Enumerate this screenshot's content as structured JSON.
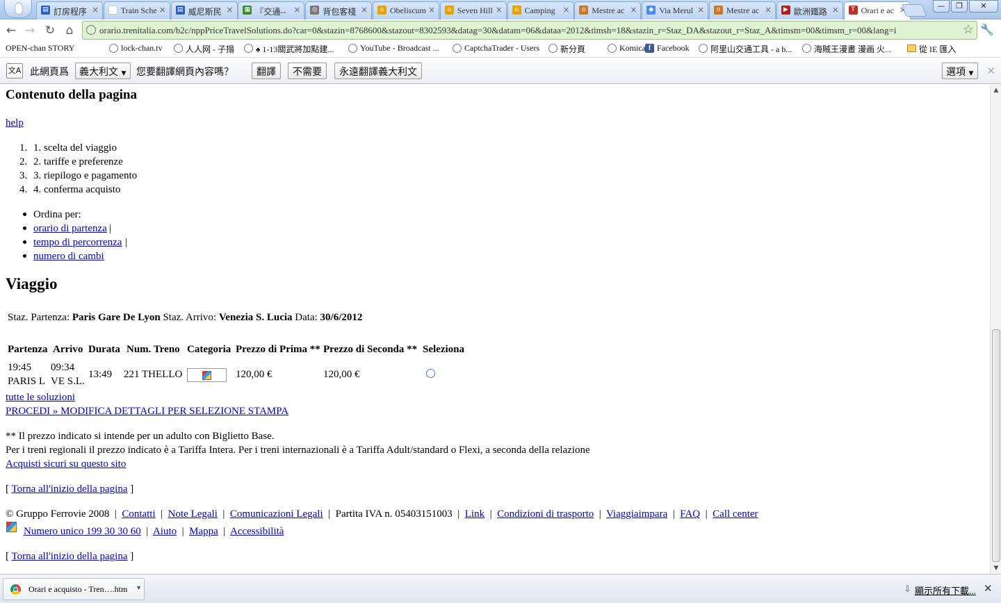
{
  "browser": {
    "tabs": [
      {
        "label": "訂房程序",
        "color": "#2d5fbf",
        "glyph": "▤"
      },
      {
        "label": "Train Sche",
        "color": "#ffffff",
        "glyph": ""
      },
      {
        "label": "威尼斯民",
        "color": "#2d5fbf",
        "glyph": "▤"
      },
      {
        "label": "『交通--",
        "color": "#3a8a3a",
        "glyph": "▦"
      },
      {
        "label": "背包客棧",
        "color": "#777777",
        "glyph": "◎"
      },
      {
        "label": "Obeliscum",
        "color": "#e8a200",
        "glyph": "⌂"
      },
      {
        "label": "Seven Hill",
        "color": "#e8a200",
        "glyph": "⌂"
      },
      {
        "label": "Camping",
        "color": "#e8a200",
        "glyph": "⌂"
      },
      {
        "label": "Mestre ac",
        "color": "#cc7722",
        "glyph": "o"
      },
      {
        "label": "Via Merul",
        "color": "#4a8af4",
        "glyph": "◆"
      },
      {
        "label": "Mestre ac",
        "color": "#cc7722",
        "glyph": "o"
      },
      {
        "label": "歐洲鐵路",
        "color": "#b02020",
        "glyph": "▶"
      },
      {
        "label": "Orari e ac",
        "color": "#c0302a",
        "glyph": "T",
        "active": true
      }
    ],
    "url": "orario.trenitalia.com/b2c/nppPriceTravelSolutions.do?car=0&stazin=8768600&stazout=8302593&datag=30&datam=06&dataa=2012&timsh=18&stazin_r=Staz_DA&stazout_r=Staz_A&timsm=00&timsm_r=00&lang=i",
    "bookmarks": [
      {
        "label": "OPEN-chan STORY",
        "icon": "none"
      },
      {
        "label": "lock-chan.tv",
        "icon": "globe"
      },
      {
        "label": "人人网 - 子搨",
        "icon": "globe"
      },
      {
        "label": "♠ 1-13關武將加點建...",
        "icon": "globe"
      },
      {
        "label": "YouTube - Broadcast ...",
        "icon": "globe"
      },
      {
        "label": "CaptchaTrader - Users",
        "icon": "globe"
      },
      {
        "label": "新分頁",
        "icon": "globe"
      },
      {
        "label": "Komica",
        "icon": "globe"
      },
      {
        "label": "Facebook",
        "icon": "facebook"
      },
      {
        "label": "阿里山交通工具 - a b...",
        "icon": "globe"
      },
      {
        "label": "海賊王漫畫 漫画 火...",
        "icon": "globe"
      },
      {
        "label": "從 IE 匯入",
        "icon": "folder"
      }
    ],
    "translate_bar": {
      "prefix": "此網頁爲",
      "language": "義大利文",
      "question": "您要翻譯網頁內容嗎？",
      "translate_btn": "翻譯",
      "no_btn": "不需要",
      "always_btn": "永遠翻譯義大利文",
      "options_btn": "選項"
    },
    "download": {
      "file": "Orari e acquisto - Tren….htm",
      "show_all": "顯示所有下載..."
    }
  },
  "page": {
    "content_heading": "Contenuto della pagina",
    "help_link": "help",
    "steps": [
      "1. scelta del viaggio",
      "2. tariffe e preferenze",
      "3. riepilogo e pagamento",
      "4. conferma acquisto"
    ],
    "steps_numbers": [
      "1.",
      "2.",
      "3.",
      "4."
    ],
    "sort_label": "Ordina per:",
    "sort_links": [
      "orario di partenza",
      "tempo di percorrenza",
      "numero di cambi"
    ],
    "sort_separator": "|",
    "viaggio_heading": "Viaggio",
    "journey": {
      "departure_label": "Staz. Partenza:",
      "departure": "Paris Gare De Lyon",
      "arrival_label": "Staz. Arrivo:",
      "arrival": "Venezia S. Lucia",
      "date_label": "Data:",
      "date": "30/6/2012"
    },
    "table": {
      "headers": [
        "Partenza",
        "Arrivo",
        "Durata",
        "Num. Treno",
        "Categoria",
        "Prezzo di Prima **",
        "Prezzo di Seconda **",
        "Seleziona"
      ],
      "row": {
        "dep_time": "19:45",
        "dep_station": "PARIS L",
        "arr_time": "09:34",
        "arr_station": "VE S.L.",
        "duration": "13:49",
        "train": "221 THELLO",
        "price_first": "120,00 €",
        "price_second": "120,00 €"
      }
    },
    "all_solutions_link": "tutte le soluzioni",
    "proceed_link": "PROCEDI » MODIFICA DETTAGLI PER SELEZIONE STAMPA",
    "note1": "** Il prezzo indicato si intende per un adulto con Biglietto Base.",
    "note2": "Per i treni regionali il prezzo indicato è a Tariffa Intera. Per i treni internazionali è a Tariffa Adult/standard o Flexi, a seconda della relazione",
    "secure_link": "Acquisti sicuri su questo sito",
    "back_top_open": "[",
    "back_top_link": "Torna all'inizio della pagina",
    "back_top_close": "]",
    "footer": {
      "copyright": "© Gruppo Ferrovie 2008",
      "links1": [
        "Contatti",
        "Note Legali",
        "Comunicazioni Legali"
      ],
      "vat": "Partita IVA n. 05403151003",
      "links2": [
        "Link",
        "Condizioni di trasporto",
        "Viaggiaimpara",
        "FAQ",
        "Call center"
      ],
      "links3": [
        "Numero unico 199 30 30 60",
        "Aiuto",
        "Mappa",
        "Accessibilità"
      ],
      "separator": "|"
    }
  }
}
